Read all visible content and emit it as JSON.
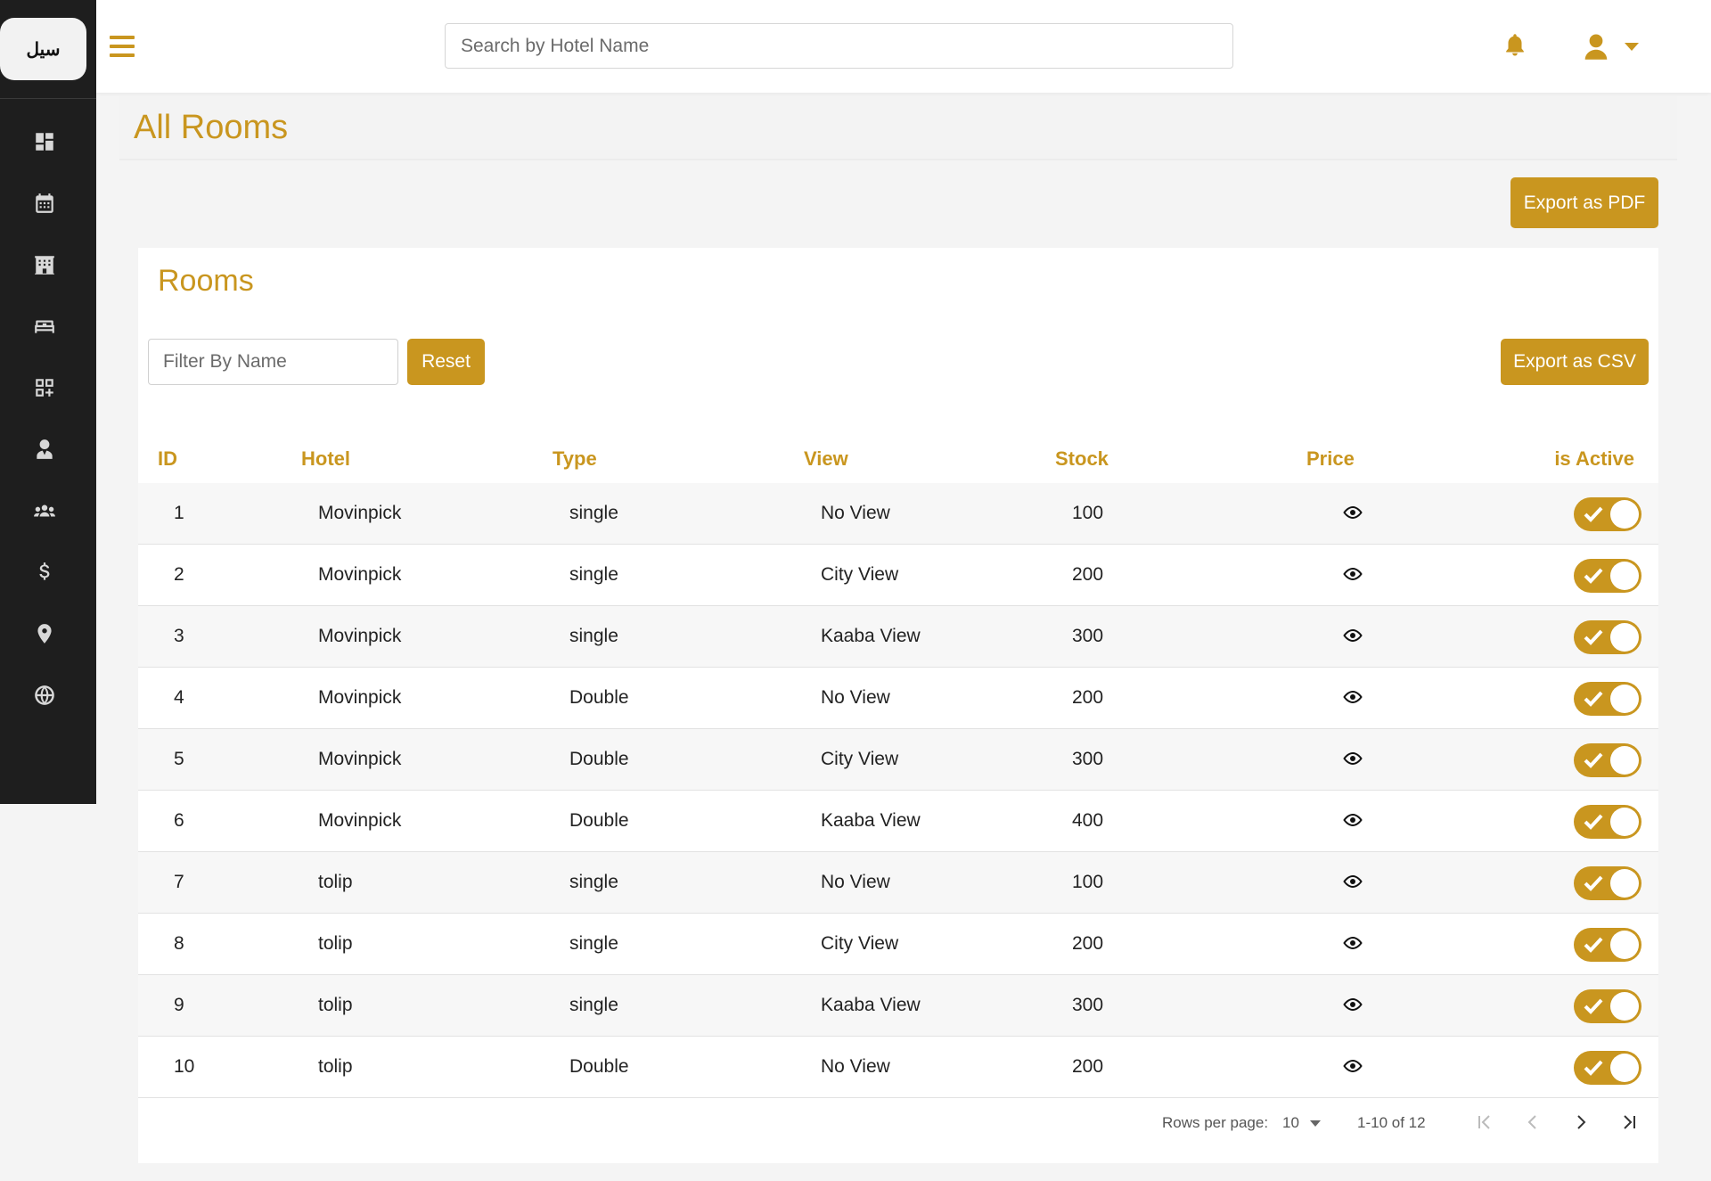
{
  "app": {
    "logo_text": "سيل"
  },
  "sidebar": {
    "items": [
      {
        "name": "dashboard-icon"
      },
      {
        "name": "calendar-icon"
      },
      {
        "name": "hotel-building-icon"
      },
      {
        "name": "bed-icon"
      },
      {
        "name": "widgets-icon"
      },
      {
        "name": "user-tie-icon"
      },
      {
        "name": "users-group-icon"
      },
      {
        "name": "dollar-icon"
      },
      {
        "name": "location-pin-icon"
      },
      {
        "name": "globe-icon"
      }
    ]
  },
  "topbar": {
    "search_placeholder": "Search by Hotel Name"
  },
  "page": {
    "title": "All Rooms",
    "export_pdf_label": "Export as PDF"
  },
  "card": {
    "title": "Rooms",
    "filter_placeholder": "Filter By Name",
    "reset_label": "Reset",
    "export_csv_label": "Export as CSV"
  },
  "table": {
    "columns": [
      "ID",
      "Hotel",
      "Type",
      "View",
      "Stock",
      "Price",
      "is Active"
    ],
    "rows": [
      {
        "id": "1",
        "hotel": "Movinpick",
        "type": "single",
        "view": "No View",
        "stock": "100",
        "active": true
      },
      {
        "id": "2",
        "hotel": "Movinpick",
        "type": "single",
        "view": "City View",
        "stock": "200",
        "active": true
      },
      {
        "id": "3",
        "hotel": "Movinpick",
        "type": "single",
        "view": "Kaaba View",
        "stock": "300",
        "active": true
      },
      {
        "id": "4",
        "hotel": "Movinpick",
        "type": "Double",
        "view": "No View",
        "stock": "200",
        "active": true
      },
      {
        "id": "5",
        "hotel": "Movinpick",
        "type": "Double",
        "view": "City View",
        "stock": "300",
        "active": true
      },
      {
        "id": "6",
        "hotel": "Movinpick",
        "type": "Double",
        "view": "Kaaba View",
        "stock": "400",
        "active": true
      },
      {
        "id": "7",
        "hotel": "tolip",
        "type": "single",
        "view": "No View",
        "stock": "100",
        "active": true
      },
      {
        "id": "8",
        "hotel": "tolip",
        "type": "single",
        "view": "City View",
        "stock": "200",
        "active": true
      },
      {
        "id": "9",
        "hotel": "tolip",
        "type": "single",
        "view": "Kaaba View",
        "stock": "300",
        "active": true
      },
      {
        "id": "10",
        "hotel": "tolip",
        "type": "Double",
        "view": "No View",
        "stock": "200",
        "active": true
      }
    ]
  },
  "pagination": {
    "rows_per_page_label": "Rows per page:",
    "rows_per_page": "10",
    "range": "1-10 of 12"
  },
  "colors": {
    "accent": "#c9961f",
    "sidebar": "#1e1e1e"
  }
}
